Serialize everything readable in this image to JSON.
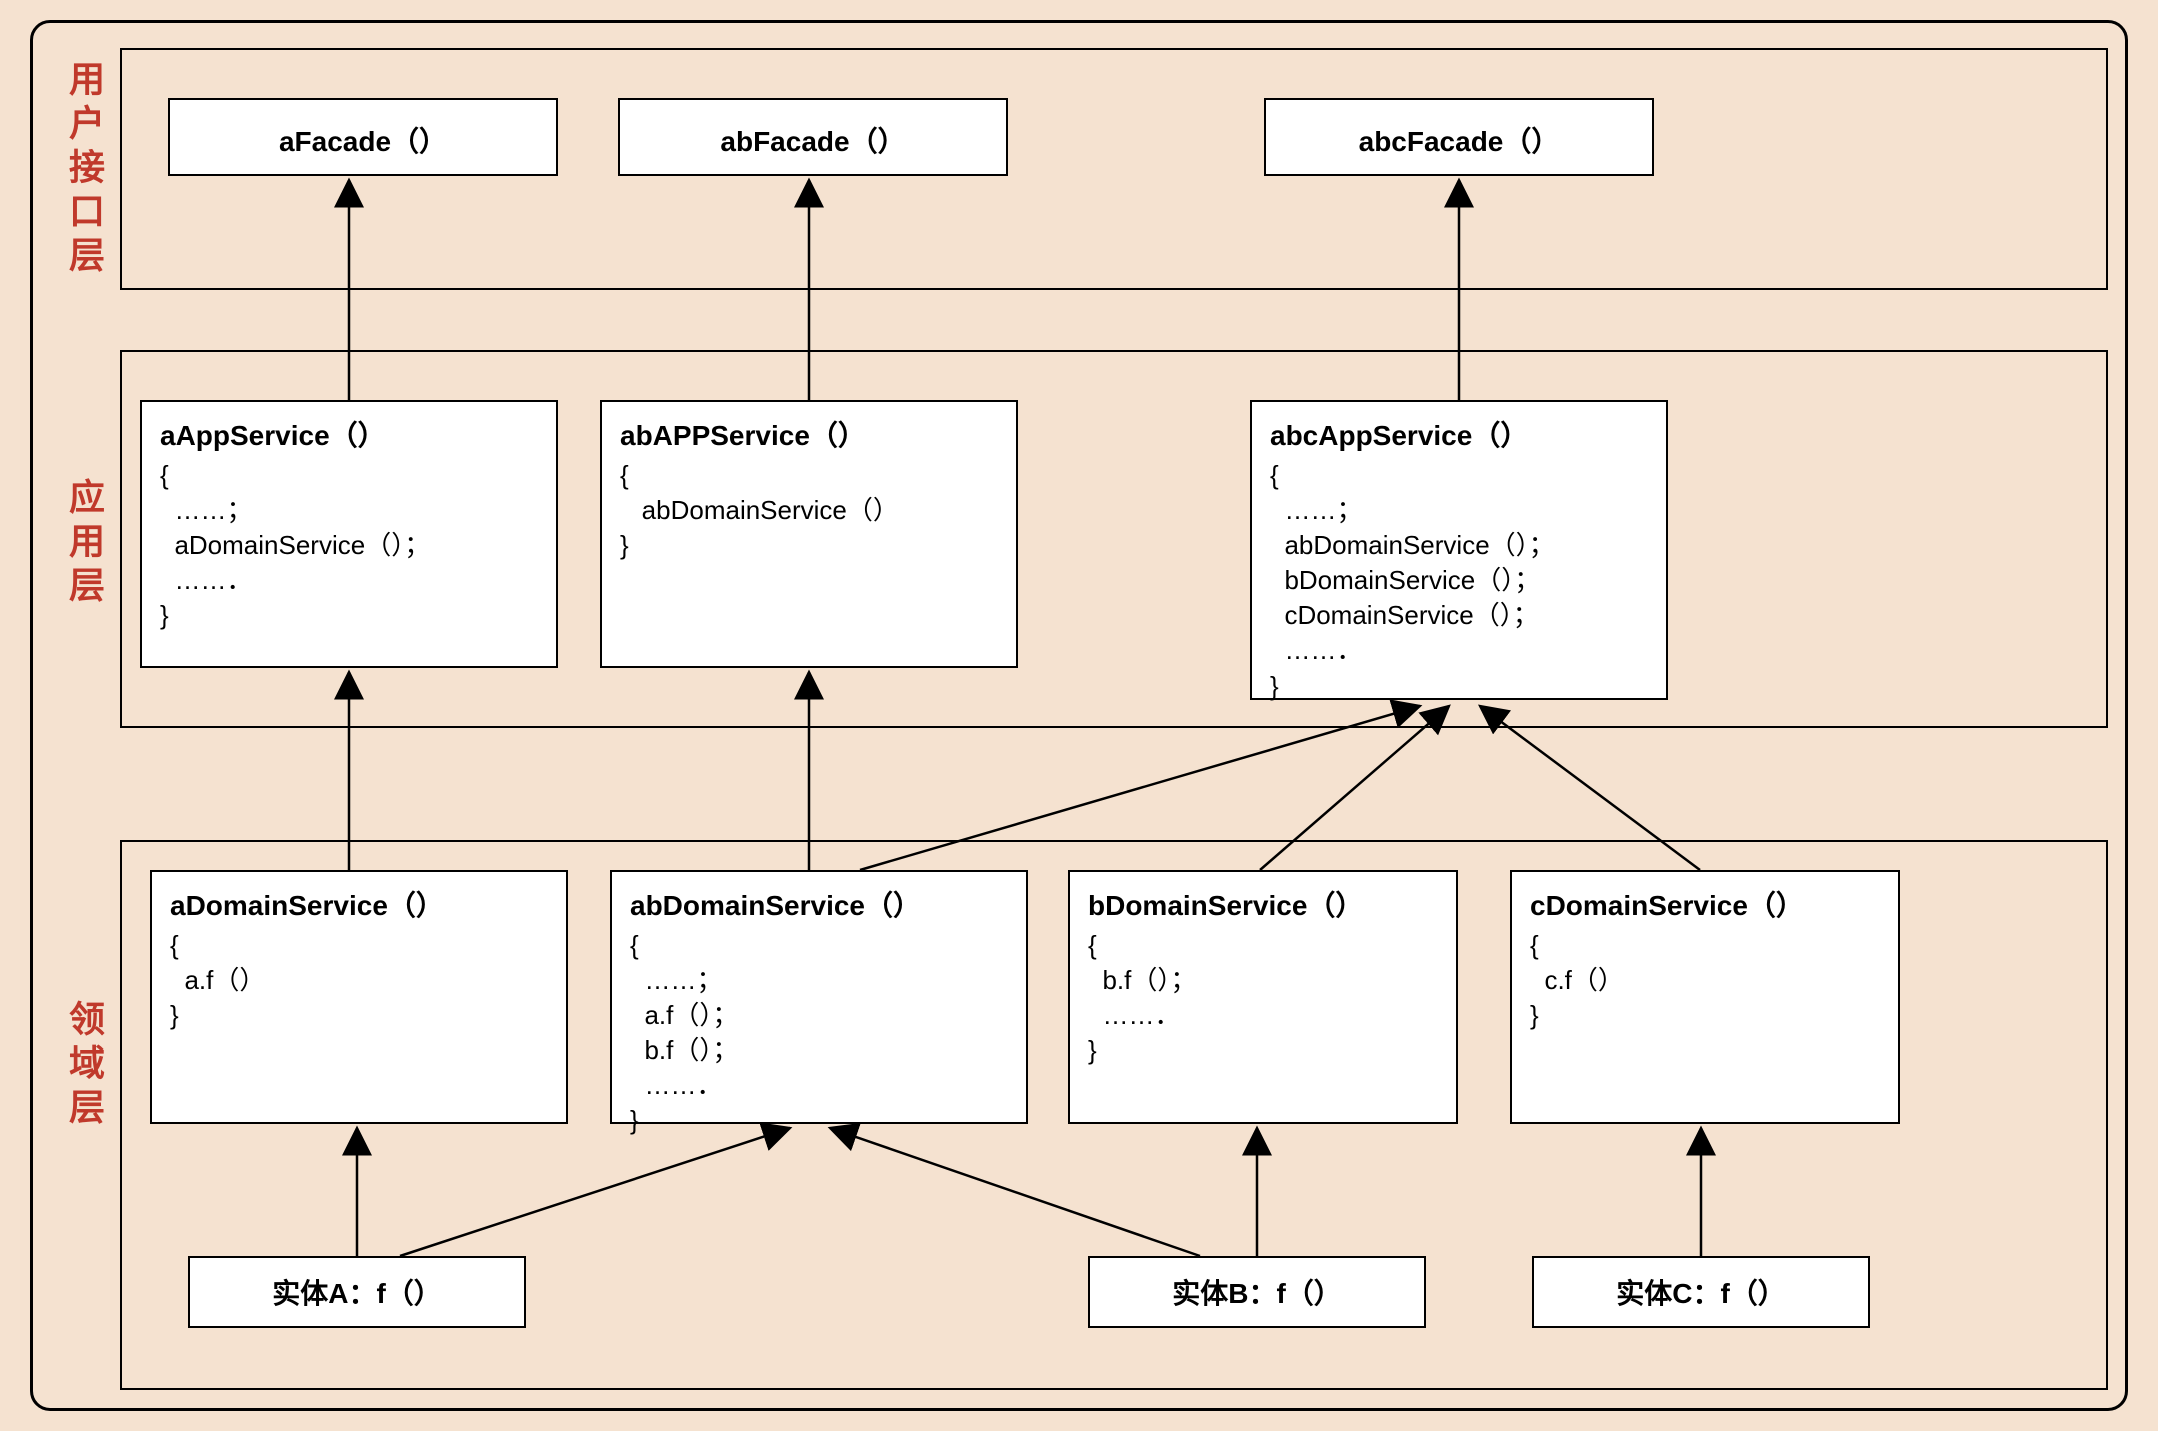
{
  "layers": {
    "ui": {
      "label": "用户接口层"
    },
    "app": {
      "label": "应用层"
    },
    "domain": {
      "label": "领域层"
    }
  },
  "facades": {
    "a": {
      "title": "aFacade（）"
    },
    "ab": {
      "title": "abFacade（）"
    },
    "abc": {
      "title": "abcFacade（）"
    }
  },
  "appServices": {
    "a": {
      "title": "aAppService（）",
      "body": "{\n  ……；\n  aDomainService（）；\n  ……．\n}"
    },
    "ab": {
      "title": "abAPPService（）",
      "body": "{\n   abDomainService（）\n}"
    },
    "abc": {
      "title": "abcAppService（）",
      "body": "{\n  ……；\n  abDomainService（）；\n  bDomainService（）；\n  cDomainService（）；\n  ……．\n}"
    }
  },
  "domainServices": {
    "a": {
      "title": "aDomainService（）",
      "body": "{\n  a.f（）\n}"
    },
    "ab": {
      "title": "abDomainService（）",
      "body": "{\n  ……；\n  a.f（）；\n  b.f（）；\n  ……．\n}"
    },
    "b": {
      "title": "bDomainService（）",
      "body": "{\n  b.f（）；\n  ……．\n}"
    },
    "c": {
      "title": "cDomainService（）",
      "body": "{\n  c.f（）\n}"
    }
  },
  "entities": {
    "a": {
      "label": "实体A：f（）"
    },
    "b": {
      "label": "实体B：f（）"
    },
    "c": {
      "label": "实体C：f（）"
    }
  }
}
